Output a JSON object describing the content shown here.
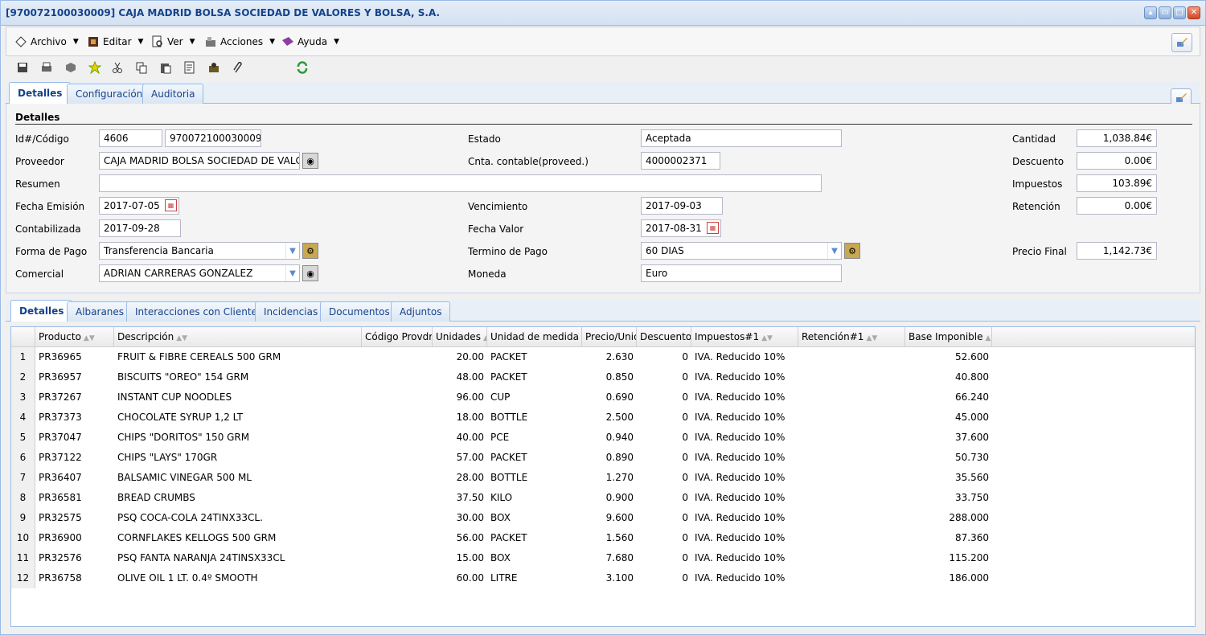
{
  "window": {
    "title": "[970072100030009] CAJA MADRID BOLSA SOCIEDAD DE VALORES Y BOLSA, S.A.",
    "controls": [
      "minimize",
      "restore",
      "maximize",
      "close"
    ]
  },
  "menu": {
    "items": [
      {
        "label": "Archivo",
        "icon": "document-icon"
      },
      {
        "label": "Editar",
        "icon": "edit-icon"
      },
      {
        "label": "Ver",
        "icon": "view-icon"
      },
      {
        "label": "Acciones",
        "icon": "actions-icon"
      },
      {
        "label": "Ayuda",
        "icon": "help-icon"
      }
    ]
  },
  "toolbar": {
    "icons": [
      "save-icon",
      "print-icon",
      "box-icon",
      "star-icon",
      "cut-icon",
      "copy-icon",
      "paste-icon",
      "report-icon",
      "tools-icon",
      "attach-icon",
      "refresh-icon"
    ]
  },
  "top_tabs": [
    "Detalles",
    "Configuración",
    "Auditoria"
  ],
  "form": {
    "section_title": "Detalles",
    "labels": {
      "id_codigo": "Id#/Código",
      "proveedor": "Proveedor",
      "resumen": "Resumen",
      "fecha_emision": "Fecha Emisión",
      "contabilizada": "Contabilizada",
      "forma_pago": "Forma de Pago",
      "comercial": "Comercial",
      "estado": "Estado",
      "cnta_contable": "Cnta. contable(proveed.)",
      "vencimiento": "Vencimiento",
      "fecha_valor": "Fecha Valor",
      "termino_pago": "Termino de Pago",
      "moneda": "Moneda",
      "cantidad": "Cantidad",
      "descuento": "Descuento",
      "impuestos": "Impuestos",
      "retencion": "Retención",
      "precio_final": "Precio Final"
    },
    "values": {
      "id": "4606",
      "codigo": "970072100030009",
      "proveedor": "CAJA MADRID BOLSA SOCIEDAD DE VALC",
      "resumen": "",
      "fecha_emision": "2017-07-05",
      "contabilizada": "2017-09-28",
      "forma_pago": "Transferencia Bancaria",
      "comercial": "ADRIAN CARRERAS GONZALEZ",
      "estado": "Aceptada",
      "cnta_contable": "4000002371",
      "vencimiento": "2017-09-03",
      "fecha_valor": "2017-08-31",
      "termino_pago": "60 DIAS",
      "moneda": "Euro",
      "cantidad": "1,038.84€",
      "descuento": "0.00€",
      "impuestos": "103.89€",
      "retencion": "0.00€",
      "precio_final": "1,142.73€"
    }
  },
  "bottom_tabs": [
    "Detalles",
    "Albaranes",
    "Interacciones con Clientes",
    "Incidencias",
    "Documentos",
    "Adjuntos"
  ],
  "grid": {
    "columns": [
      "Producto",
      "Descripción",
      "Código Provdr.",
      "Unidades",
      "Unidad de medida",
      "Precio/Unidad",
      "Descuento",
      "Impuestos#1",
      "Retención#1",
      "Base Imponible"
    ],
    "rows": [
      {
        "n": "1",
        "producto": "PR36965",
        "descripcion": "FRUIT & FIBRE CEREALS 500 GRM",
        "codigo": "",
        "unidades": "20.00",
        "unidad": "PACKET",
        "precio": "2.630",
        "descuento": "0",
        "impuestos": "IVA. Reducido 10%",
        "retencion": "",
        "base": "52.600"
      },
      {
        "n": "2",
        "producto": "PR36957",
        "descripcion": "BISCUITS \"OREO\" 154 GRM",
        "codigo": "",
        "unidades": "48.00",
        "unidad": "PACKET",
        "precio": "0.850",
        "descuento": "0",
        "impuestos": "IVA. Reducido 10%",
        "retencion": "",
        "base": "40.800"
      },
      {
        "n": "3",
        "producto": "PR37267",
        "descripcion": "INSTANT CUP NOODLES",
        "codigo": "",
        "unidades": "96.00",
        "unidad": "CUP",
        "precio": "0.690",
        "descuento": "0",
        "impuestos": "IVA. Reducido 10%",
        "retencion": "",
        "base": "66.240"
      },
      {
        "n": "4",
        "producto": "PR37373",
        "descripcion": "CHOCOLATE SYRUP 1,2 LT",
        "codigo": "",
        "unidades": "18.00",
        "unidad": "BOTTLE",
        "precio": "2.500",
        "descuento": "0",
        "impuestos": "IVA. Reducido 10%",
        "retencion": "",
        "base": "45.000"
      },
      {
        "n": "5",
        "producto": "PR37047",
        "descripcion": "CHIPS \"DORITOS\" 150 GRM",
        "codigo": "",
        "unidades": "40.00",
        "unidad": "PCE",
        "precio": "0.940",
        "descuento": "0",
        "impuestos": "IVA. Reducido 10%",
        "retencion": "",
        "base": "37.600"
      },
      {
        "n": "6",
        "producto": "PR37122",
        "descripcion": "CHIPS \"LAYS\" 170GR",
        "codigo": "",
        "unidades": "57.00",
        "unidad": "PACKET",
        "precio": "0.890",
        "descuento": "0",
        "impuestos": "IVA. Reducido 10%",
        "retencion": "",
        "base": "50.730"
      },
      {
        "n": "7",
        "producto": "PR36407",
        "descripcion": "BALSAMIC VINEGAR 500 ML",
        "codigo": "",
        "unidades": "28.00",
        "unidad": "BOTTLE",
        "precio": "1.270",
        "descuento": "0",
        "impuestos": "IVA. Reducido 10%",
        "retencion": "",
        "base": "35.560"
      },
      {
        "n": "8",
        "producto": "PR36581",
        "descripcion": "BREAD CRUMBS",
        "codigo": "",
        "unidades": "37.50",
        "unidad": "KILO",
        "precio": "0.900",
        "descuento": "0",
        "impuestos": "IVA. Reducido 10%",
        "retencion": "",
        "base": "33.750"
      },
      {
        "n": "9",
        "producto": "PR32575",
        "descripcion": "PSQ COCA-COLA 24TINX33CL.",
        "codigo": "",
        "unidades": "30.00",
        "unidad": "BOX",
        "precio": "9.600",
        "descuento": "0",
        "impuestos": "IVA. Reducido 10%",
        "retencion": "",
        "base": "288.000"
      },
      {
        "n": "10",
        "producto": "PR36900",
        "descripcion": "CORNFLAKES KELLOGS 500 GRM",
        "codigo": "",
        "unidades": "56.00",
        "unidad": "PACKET",
        "precio": "1.560",
        "descuento": "0",
        "impuestos": "IVA. Reducido 10%",
        "retencion": "",
        "base": "87.360"
      },
      {
        "n": "11",
        "producto": "PR32576",
        "descripcion": "PSQ FANTA NARANJA 24TINSX33CL",
        "codigo": "",
        "unidades": "15.00",
        "unidad": "BOX",
        "precio": "7.680",
        "descuento": "0",
        "impuestos": "IVA. Reducido 10%",
        "retencion": "",
        "base": "115.200"
      },
      {
        "n": "12",
        "producto": "PR36758",
        "descripcion": "OLIVE OIL 1 LT. 0.4º SMOOTH",
        "codigo": "",
        "unidades": "60.00",
        "unidad": "LITRE",
        "precio": "3.100",
        "descuento": "0",
        "impuestos": "IVA. Reducido 10%",
        "retencion": "",
        "base": "186.000"
      }
    ]
  }
}
